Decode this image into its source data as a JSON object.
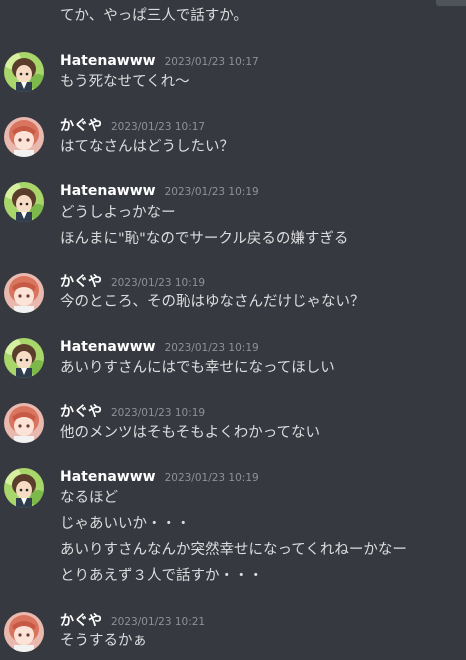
{
  "channel": {
    "pre_message": "てか、やっぱ三人で話すか。",
    "messages": [
      {
        "author": "Hatenawww",
        "time": "2023/01/23 10:17",
        "avatar": "green-character-avatar",
        "lines": [
          "もう死なせてくれ〜"
        ]
      },
      {
        "author": "かぐや",
        "time": "2023/01/23 10:17",
        "avatar": "pink-character-avatar",
        "lines": [
          "はてなさんはどうしたい？"
        ]
      },
      {
        "author": "Hatenawww",
        "time": "2023/01/23 10:19",
        "avatar": "green-character-avatar",
        "lines": [
          "どうしよっかなー",
          "ほんまに\"恥\"なのでサークル戻るの嫌すぎる"
        ]
      },
      {
        "author": "かぐや",
        "time": "2023/01/23 10:19",
        "avatar": "pink-character-avatar",
        "lines": [
          "今のところ、その恥はゆなさんだけじゃない？"
        ]
      },
      {
        "author": "Hatenawww",
        "time": "2023/01/23 10:19",
        "avatar": "green-character-avatar",
        "lines": [
          "あいりすさんにはでも幸せになってほしい"
        ]
      },
      {
        "author": "かぐや",
        "time": "2023/01/23 10:19",
        "avatar": "pink-character-avatar",
        "lines": [
          "他のメンツはそもそもよくわかってない"
        ]
      },
      {
        "author": "Hatenawww",
        "time": "2023/01/23 10:19",
        "avatar": "green-character-avatar",
        "lines": [
          "なるほど",
          "じゃあいいか・・・",
          "あいりすさんなんか突然幸せになってくれねーかなー",
          "とりあえず３人で話すか・・・"
        ]
      },
      {
        "author": "かぐや",
        "time": "2023/01/23 10:21",
        "avatar": "pink-character-avatar",
        "lines": [
          "そうするかぁ"
        ]
      }
    ]
  },
  "colors": {
    "background": "#36393f",
    "username": "#ffffff",
    "timestamp": "#8e9297",
    "text": "#dcddde"
  }
}
